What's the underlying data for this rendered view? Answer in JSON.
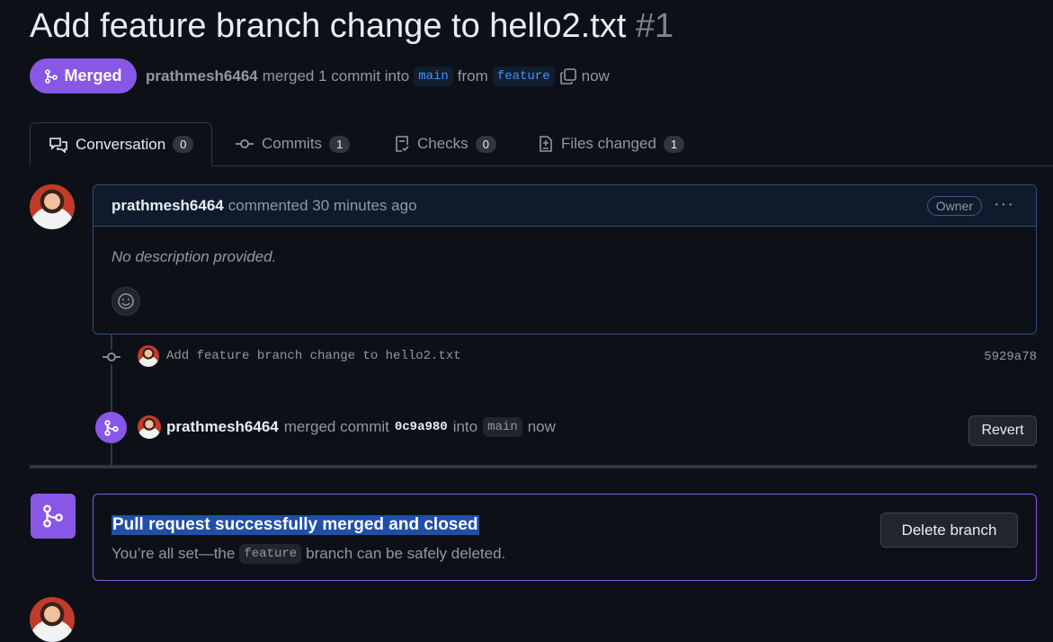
{
  "pr": {
    "title": "Add feature branch change to hello2.txt",
    "number": "#1",
    "state": "Merged"
  },
  "meta": {
    "user": "prathmesh6464",
    "merged_text": "merged 1 commit into",
    "base_branch": "main",
    "from_text": "from",
    "head_branch": "feature",
    "time": "now"
  },
  "tabs": [
    {
      "label": "Conversation",
      "count": "0",
      "icon": "comment-discussion-icon"
    },
    {
      "label": "Commits",
      "count": "1",
      "icon": "git-commit-icon"
    },
    {
      "label": "Checks",
      "count": "0",
      "icon": "checklist-icon"
    },
    {
      "label": "Files changed",
      "count": "1",
      "icon": "file-diff-icon"
    }
  ],
  "comment": {
    "author": "prathmesh6464",
    "action": "commented 30 minutes ago",
    "badge": "Owner",
    "menu": "···",
    "body": "No description provided."
  },
  "commit": {
    "message": "Add feature branch change to hello2.txt",
    "sha": "5929a78"
  },
  "merge_event": {
    "user": "prathmesh6464",
    "text1": "merged commit",
    "sha": "0c9a980",
    "text2": "into",
    "branch": "main",
    "time": "now",
    "revert_label": "Revert"
  },
  "merge_box": {
    "title": "Pull request successfully merged and closed",
    "sub_prefix": "You’re all set—the",
    "branch": "feature",
    "sub_suffix": "branch can be safely deleted.",
    "delete_label": "Delete branch"
  },
  "colors": {
    "merged": "#8957e5",
    "link": "#4493f8",
    "bg": "#0d1117"
  }
}
